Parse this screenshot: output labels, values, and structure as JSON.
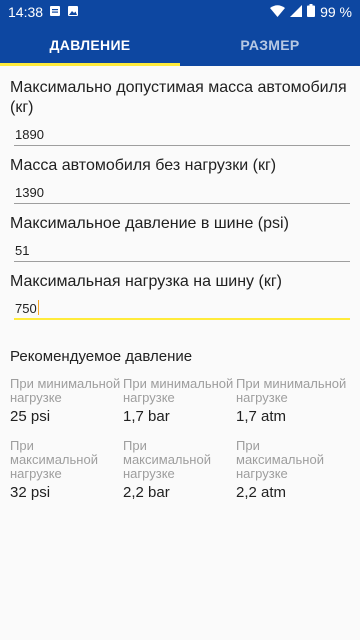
{
  "status": {
    "time": "14:38",
    "battery": "99 %",
    "icons_left": [
      "notification-doc-icon",
      "notification-image-icon"
    ],
    "icons_right": [
      "wifi-icon",
      "signal-icon",
      "battery-icon"
    ]
  },
  "tabs": [
    {
      "label": "ДАВЛЕНИЕ",
      "active": true
    },
    {
      "label": "РАЗМЕР",
      "active": false
    }
  ],
  "form": {
    "fields": [
      {
        "label": "Максимально допустимая масса автомобиля (кг)",
        "value": "1890"
      },
      {
        "label": "Масса автомобиля без нагрузки (кг)",
        "value": "1390"
      },
      {
        "label": "Максимальное давление в шине (psi)",
        "value": "51"
      },
      {
        "label": "Максимальная нагрузка на шину (кг)",
        "value": "750"
      }
    ]
  },
  "result": {
    "title": "Рекомендуемое давление",
    "min_label": "При минимальной нагрузке",
    "max_label": "При максимальной нагрузке",
    "min": [
      "25 psi",
      "1,7 bar",
      "1,7 atm"
    ],
    "max": [
      "32 psi",
      "2,2 bar",
      "2,2 atm"
    ]
  },
  "colors": {
    "primary": "#0d47a1",
    "accent": "#ffeb3b"
  }
}
